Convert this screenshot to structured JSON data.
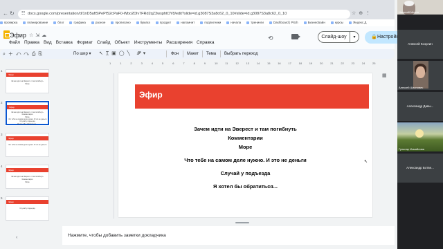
{
  "browser": {
    "url": "docs.google.com/presentation/d/1nD5aftSPePfS2cPaF0-Wbo2Dlv7FRd2qZ3wsphtOY8/edit?slide=id.g3087S3a8c62_0_10#slide=id.g3087S3a8c62_0_10",
    "bookmarks": [
      "проверка",
      "планирование",
      "блог",
      "графика",
      "разное",
      "прописано",
      "бумага",
      "продукт",
      "напомнит",
      "подписчики",
      "начала",
      "тренинги",
      "Dashboard | Pitch",
      "БизнесБайн",
      "курсы",
      "Яндекс.Д"
    ]
  },
  "doc": {
    "title": "Эфир",
    "menu": [
      "Файл",
      "Правка",
      "Вид",
      "Вставка",
      "Формат",
      "Слайд",
      "Объект",
      "Инструменты",
      "Расширения",
      "Справка"
    ],
    "present_label": "Слайд-шоу",
    "share_label": "Настройки доступа"
  },
  "toolbar": {
    "zoom_label": "По шир",
    "background_label": "Фон",
    "layout_label": "Макет",
    "theme_label": "Тема",
    "transition_label": "Выбрать переход"
  },
  "filmstrip": {
    "slides": [
      {
        "num": "1",
        "bar": "Эфир",
        "lines": [
          "Зачем идти на Эверест и там погибнуть",
          "Море"
        ]
      },
      {
        "num": "2",
        "bar": "Эфир",
        "lines": [
          "Зачем идти на Эверест и там погибнуть",
          "Комментарии",
          "Море",
          "Что тебе на самом деле нужно. И это не деньги",
          "Случай у подъезда",
          "Я хотел бы обратиться..."
        ]
      },
      {
        "num": "3",
        "bar": "Эфир",
        "lines": [
          "Что тебе на самом деле нужно. И это не деньги"
        ]
      },
      {
        "num": "4",
        "bar": "Эфир",
        "lines": [
          "Зачем идти на Эверест и там погибнуть",
          "Комментарии",
          "Море"
        ]
      },
      {
        "num": "5",
        "bar": "Эфир",
        "lines": [
          "Случай у подъезда"
        ]
      }
    ]
  },
  "ruler": [
    "1",
    "1",
    "2",
    "3",
    "4",
    "5",
    "6",
    "7",
    "8",
    "9",
    "10",
    "11",
    "12",
    "13",
    "14",
    "15",
    "16",
    "17",
    "18",
    "19",
    "20",
    "21",
    "22",
    "23",
    "24",
    "25"
  ],
  "slide": {
    "title": "Эфир",
    "lines": [
      "Зачем идти на Эверест и там погибнуть",
      "Комментарии",
      "Море",
      "Что тебе на самом деле нужно. И это не деньги",
      "Случай у подъезда",
      "Я хотел бы обратиться..."
    ]
  },
  "notes": {
    "placeholder": "Нажмите, чтобы добавить заметки докладчика"
  },
  "meet": {
    "participants": [
      "Николай Митин",
      "Алексей Козулин",
      "Алексей Шахнович",
      "Александр Давы...",
      "Гульнар Исмайлова",
      "Александр Ботве..."
    ]
  }
}
